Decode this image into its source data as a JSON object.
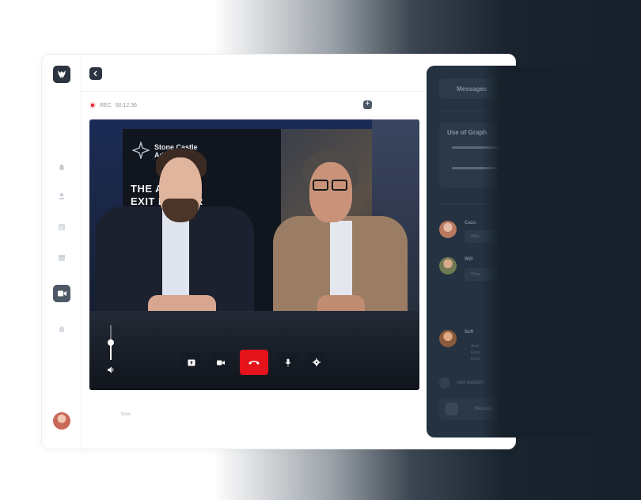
{
  "recording": {
    "label": "REC",
    "time": "00:12:36"
  },
  "video": {
    "screen_brand_line1": "Stone Castle",
    "screen_brand_line2": "Ad",
    "screen_title_line1": "THE    ABLE",
    "screen_title_line2": "EXIT    ERATOR",
    "volume_level": 0.5
  },
  "footer": {
    "note": "Now"
  },
  "chat": {
    "tab_label": "Messages",
    "card_title": "Use of Graph",
    "messages": [
      {
        "name": "Cass",
        "text": "Wha"
      },
      {
        "name": "Will",
        "text": "Thou"
      },
      {
        "name": "Sofi",
        "lines": [
          "Anal",
          "Rese",
          "Beha"
        ]
      }
    ],
    "reaction_label": "Add reaction",
    "input_placeholder": "Message"
  },
  "colors": {
    "end_call": "#e4131c",
    "rec_dot": "#e3222c",
    "sidebar_active": "#4d5866"
  }
}
